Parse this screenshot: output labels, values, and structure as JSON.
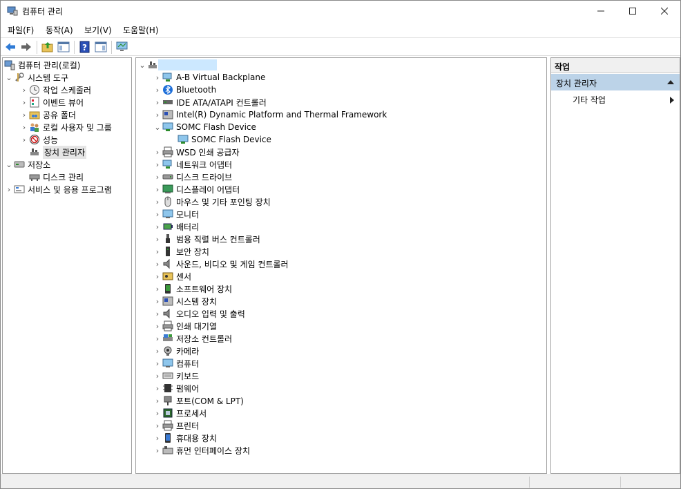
{
  "window": {
    "title": "컴퓨터 관리"
  },
  "menubar": {
    "items": [
      "파일(F)",
      "동작(A)",
      "보기(V)",
      "도움말(H)"
    ]
  },
  "toolbar": {
    "buttons": [
      "back-icon",
      "forward-icon",
      "up-folder-icon",
      "show-hide-tree-icon",
      "help-icon",
      "show-hide-action-icon",
      "monitor-icon"
    ]
  },
  "left_tree": {
    "root": "컴퓨터 관리(로컬)",
    "system_tools": "시스템 도구",
    "task_scheduler": "작업 스케줄러",
    "event_viewer": "이벤트 뷰어",
    "shared_folders": "공유 폴더",
    "local_users": "로컬 사용자 및 그룹",
    "performance": "성능",
    "device_manager": "장치 관리자",
    "storage": "저장소",
    "disk_management": "디스크 관리",
    "services_apps": "서비스 및 응용 프로그램"
  },
  "device_tree": {
    "root": "",
    "items": [
      {
        "label": "A-B Virtual Backplane",
        "icon": "network-adapter-icon"
      },
      {
        "label": "Bluetooth",
        "icon": "bluetooth-icon"
      },
      {
        "label": "IDE ATA/ATAPI 컨트롤러",
        "icon": "ide-controller-icon"
      },
      {
        "label": "Intel(R) Dynamic Platform and Thermal Framework",
        "icon": "system-device-icon"
      },
      {
        "label": "SOMC Flash Device",
        "icon": "monitor-device-icon",
        "expanded": true
      },
      {
        "label": "SOMC Flash Device",
        "icon": "monitor-device-icon",
        "child": true
      },
      {
        "label": "WSD 인쇄 공급자",
        "icon": "printer-icon"
      },
      {
        "label": "네트워크 어댑터",
        "icon": "network-adapter-icon"
      },
      {
        "label": "디스크 드라이브",
        "icon": "disk-drive-icon"
      },
      {
        "label": "디스플레이 어댑터",
        "icon": "display-adapter-icon"
      },
      {
        "label": "마우스 및 기타 포인팅 장치",
        "icon": "mouse-icon"
      },
      {
        "label": "모니터",
        "icon": "monitor-icon"
      },
      {
        "label": "배터리",
        "icon": "battery-icon"
      },
      {
        "label": "범용 직렬 버스 컨트롤러",
        "icon": "usb-icon"
      },
      {
        "label": "보안 장치",
        "icon": "security-device-icon"
      },
      {
        "label": "사운드, 비디오 및 게임 컨트롤러",
        "icon": "speaker-icon"
      },
      {
        "label": "센서",
        "icon": "sensor-icon"
      },
      {
        "label": "소프트웨어 장치",
        "icon": "software-device-icon"
      },
      {
        "label": "시스템 장치",
        "icon": "system-device-icon"
      },
      {
        "label": "오디오 입력 및 출력",
        "icon": "speaker-icon"
      },
      {
        "label": "인쇄 대기열",
        "icon": "printer-icon"
      },
      {
        "label": "저장소 컨트롤러",
        "icon": "storage-controller-icon"
      },
      {
        "label": "카메라",
        "icon": "camera-icon"
      },
      {
        "label": "컴퓨터",
        "icon": "computer-icon"
      },
      {
        "label": "키보드",
        "icon": "keyboard-icon"
      },
      {
        "label": "펌웨어",
        "icon": "firmware-icon"
      },
      {
        "label": "포트(COM & LPT)",
        "icon": "port-icon"
      },
      {
        "label": "프로세서",
        "icon": "processor-icon"
      },
      {
        "label": "프린터",
        "icon": "printer-icon"
      },
      {
        "label": "휴대용 장치",
        "icon": "portable-device-icon"
      },
      {
        "label": "휴먼 인터페이스 장치",
        "icon": "hid-icon"
      }
    ]
  },
  "actions": {
    "title": "작업",
    "group": "장치 관리자",
    "sub": "기타 작업"
  }
}
